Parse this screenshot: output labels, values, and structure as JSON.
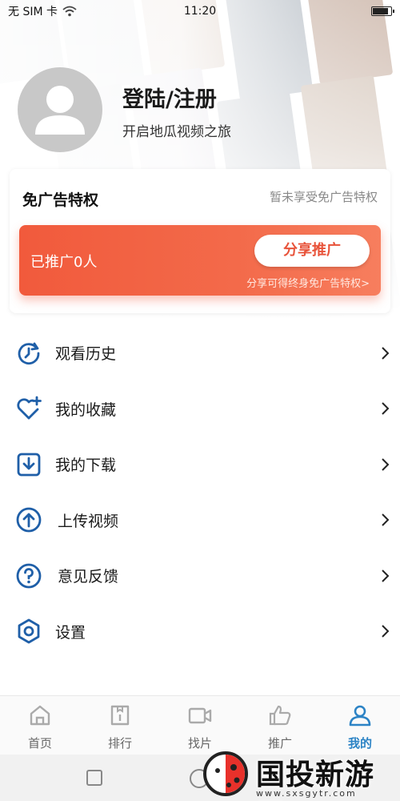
{
  "status_bar": {
    "carrier": "无 SIM 卡",
    "time": "11:20",
    "icons": [
      "wifi-icon",
      "battery-icon"
    ]
  },
  "profile": {
    "avatar_icon": "user-avatar-icon",
    "title": "登陆/注册",
    "subtitle": "开启地瓜视频之旅"
  },
  "privilege": {
    "title": "免广告特权",
    "status": "暂未享受免广告特权",
    "promoted_count_text": "已推广0人",
    "share_button": "分享推广",
    "share_link": "分享可得终身免广告特权>",
    "colors": {
      "promo_start": "#f15a3c",
      "promo_end": "#f77e5e",
      "button_text": "#e8533a"
    }
  },
  "menu": [
    {
      "label": "观看历史",
      "icon": "history-icon"
    },
    {
      "label": "我的收藏",
      "icon": "heart-plus-icon"
    },
    {
      "label": "我的下载",
      "icon": "download-icon"
    },
    {
      "label": "上传视频",
      "icon": "upload-icon"
    },
    {
      "label": "意见反馈",
      "icon": "help-icon"
    },
    {
      "label": "设置",
      "icon": "settings-icon"
    }
  ],
  "tabs": [
    {
      "label": "首页",
      "icon": "home-icon",
      "active": false
    },
    {
      "label": "排行",
      "icon": "ranking-icon",
      "active": false
    },
    {
      "label": "找片",
      "icon": "video-camera-icon",
      "active": false
    },
    {
      "label": "推广",
      "icon": "thumbs-up-icon",
      "active": false
    },
    {
      "label": "我的",
      "icon": "profile-icon",
      "active": true
    }
  ],
  "theme": {
    "accent": "#2c83c5",
    "icon_blue": "#1f5fa8"
  },
  "watermark": {
    "text": "国投新游网",
    "url": "www.sxsgytr.com"
  }
}
